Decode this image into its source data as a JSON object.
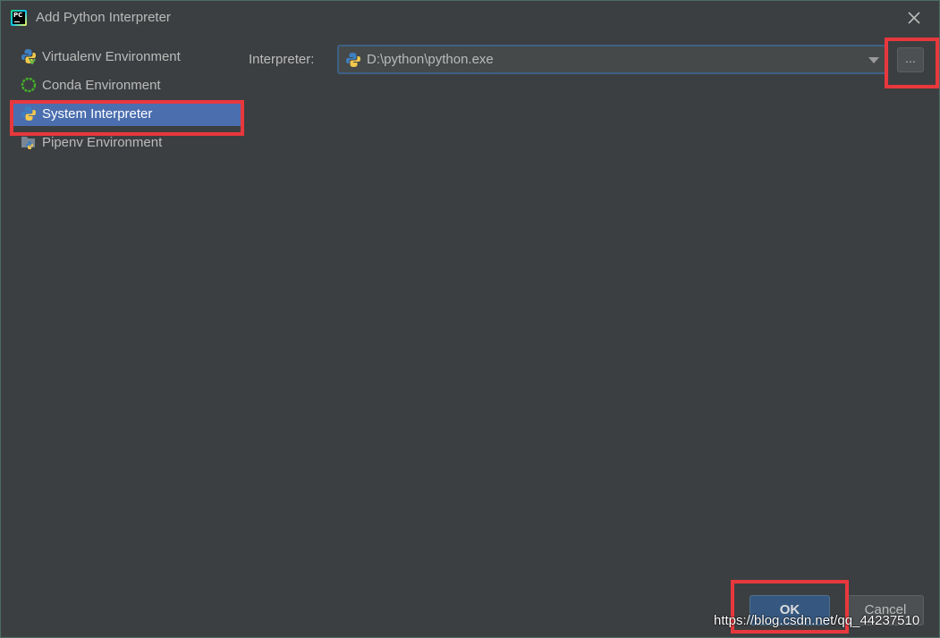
{
  "window": {
    "title": "Add Python Interpreter",
    "app_icon": "pycharm-icon",
    "app_icon_text": "PC",
    "close_icon": "close-icon"
  },
  "sidebar": {
    "items": [
      {
        "label": "Virtualenv Environment",
        "icon": "virtualenv-icon",
        "selected": false
      },
      {
        "label": "Conda Environment",
        "icon": "conda-icon",
        "selected": false
      },
      {
        "label": "System Interpreter",
        "icon": "python-icon",
        "selected": true
      },
      {
        "label": "Pipenv Environment",
        "icon": "pipenv-icon",
        "selected": false
      }
    ]
  },
  "interpreter": {
    "label": "Interpreter:",
    "value": "D:\\python\\python.exe",
    "icon": "python-icon",
    "browse_label": "..."
  },
  "footer": {
    "ok_label": "OK",
    "cancel_label": "Cancel"
  },
  "watermark": "https://blog.csdn.net/qq_44237510",
  "colors": {
    "background": "#3c3f41",
    "selection": "#4b6eaf",
    "highlight": "#e8383d",
    "ok_button": "#365880"
  }
}
